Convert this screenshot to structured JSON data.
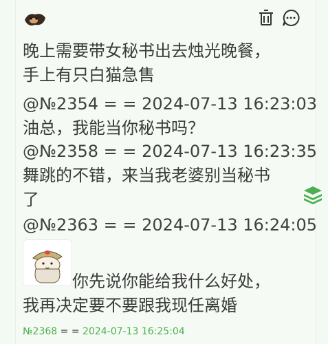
{
  "post": {
    "text_line1": "晚上需要带女秘书出去烛光晚餐，",
    "text_line2": "手上有只白猫急售"
  },
  "replies": [
    {
      "meta": "@№2354 = = 2024-07-13 16:23:03",
      "text": "油总，我能当你秘书吗？"
    },
    {
      "meta": "@№2358 = = 2024-07-13 16:23:35",
      "text_line1": "舞跳的不错，来当我老婆别当秘书",
      "text_line2": "了"
    },
    {
      "meta": "@№2363 = = 2024-07-13 16:24:05",
      "text_line1": "你先说你能给我什么好处，",
      "text_line2": "我再决定要不要跟我现任离婚"
    }
  ],
  "footer": {
    "id": "№2368",
    "eq": "= =",
    "timestamp": "2024-07-13 16:25:04"
  },
  "icons": {
    "avatar": "user-avatar-icon",
    "trash": "trash-icon",
    "more": "more-options-icon",
    "stack": "layers-icon",
    "sticker": "sticker-image"
  },
  "colors": {
    "background": "#f5fbf4",
    "footer_green": "#4caf50",
    "stack_green": "#4caf50"
  }
}
